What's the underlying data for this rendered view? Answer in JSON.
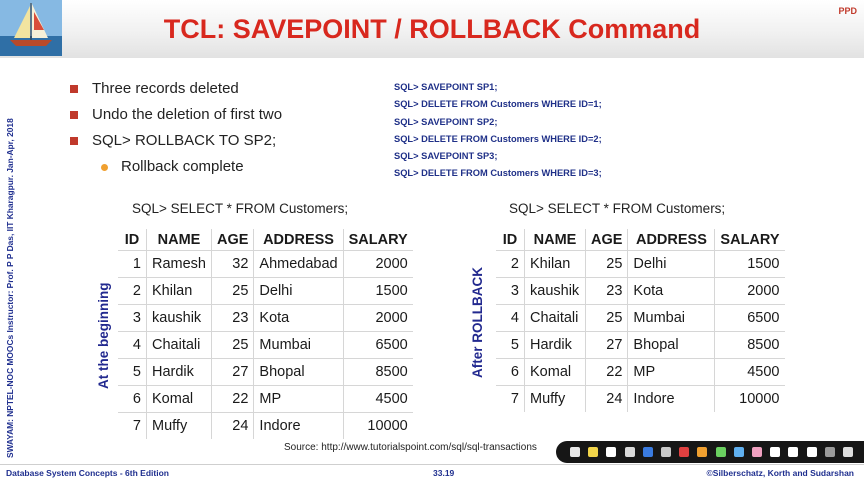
{
  "header": {
    "title": "TCL: SAVEPOINT / ROLLBACK Command",
    "badge": "PPD",
    "logo_icon": "sailboat-logo"
  },
  "sidebar_text": "SWAYAM: NPTEL-NOC MOOCs Instructor: Prof. P P Das, IIT Kharagpur. Jan-Apr, 2018",
  "bullets": {
    "b1": "Three records deleted",
    "b2": "Undo the deletion of first two",
    "b3": "SQL> ROLLBACK TO SP2;",
    "sub1": "Rollback complete"
  },
  "sql_commands": [
    "SQL> SAVEPOINT SP1;",
    "SQL> DELETE FROM Customers WHERE ID=1;",
    "SQL> SAVEPOINT SP2;",
    "SQL> DELETE FROM Customers WHERE ID=2;",
    "SQL> SAVEPOINT SP3;",
    "SQL> DELETE FROM Customers WHERE ID=3;"
  ],
  "left_table": {
    "query": "SQL> SELECT * FROM Customers;",
    "side_label": "At the beginning",
    "headers": [
      "ID",
      "NAME",
      "AGE",
      "ADDRESS",
      "SALARY"
    ],
    "rows": [
      [
        "1",
        "Ramesh",
        "32",
        "Ahmedabad",
        "2000"
      ],
      [
        "2",
        "Khilan",
        "25",
        "Delhi",
        "1500"
      ],
      [
        "3",
        "kaushik",
        "23",
        "Kota",
        "2000"
      ],
      [
        "4",
        "Chaitali",
        "25",
        "Mumbai",
        "6500"
      ],
      [
        "5",
        "Hardik",
        "27",
        "Bhopal",
        "8500"
      ],
      [
        "6",
        "Komal",
        "22",
        "MP",
        "4500"
      ],
      [
        "7",
        "Muffy",
        "24",
        "Indore",
        "10000"
      ]
    ]
  },
  "right_table": {
    "query": "SQL> SELECT * FROM Customers;",
    "side_label": "After ROLLBACK",
    "headers": [
      "ID",
      "NAME",
      "AGE",
      "ADDRESS",
      "SALARY"
    ],
    "rows": [
      [
        "2",
        "Khilan",
        "25",
        "Delhi",
        "1500"
      ],
      [
        "3",
        "kaushik",
        "23",
        "Kota",
        "2000"
      ],
      [
        "4",
        "Chaitali",
        "25",
        "Mumbai",
        "6500"
      ],
      [
        "5",
        "Hardik",
        "27",
        "Bhopal",
        "8500"
      ],
      [
        "6",
        "Komal",
        "22",
        "MP",
        "4500"
      ],
      [
        "7",
        "Muffy",
        "24",
        "Indore",
        "10000"
      ]
    ]
  },
  "source": "Source: http://www.tutorialspoint.com/sql/sql-transactions",
  "toolbar_icons": [
    "arrow-icon",
    "highlighter-icon",
    "pen-icon",
    "eraser-icon",
    "pen-icon",
    "pen-icon",
    "pen-icon",
    "marker-icon",
    "marker-icon",
    "marker-icon",
    "eraser-icon",
    "pointer-icon",
    "laser-icon",
    "laser-icon",
    "screen-icon",
    "close-icon"
  ],
  "footer": {
    "left": "Database System Concepts - 6th Edition",
    "center": "33.19",
    "right": "©Silberschatz, Korth and Sudarshan"
  },
  "colors": {
    "title": "#d8281e",
    "bullet_square": "#c0392b",
    "bullet_dot": "#f0a030",
    "sql_text": "#1f3088",
    "label_blue": "#22298f"
  }
}
